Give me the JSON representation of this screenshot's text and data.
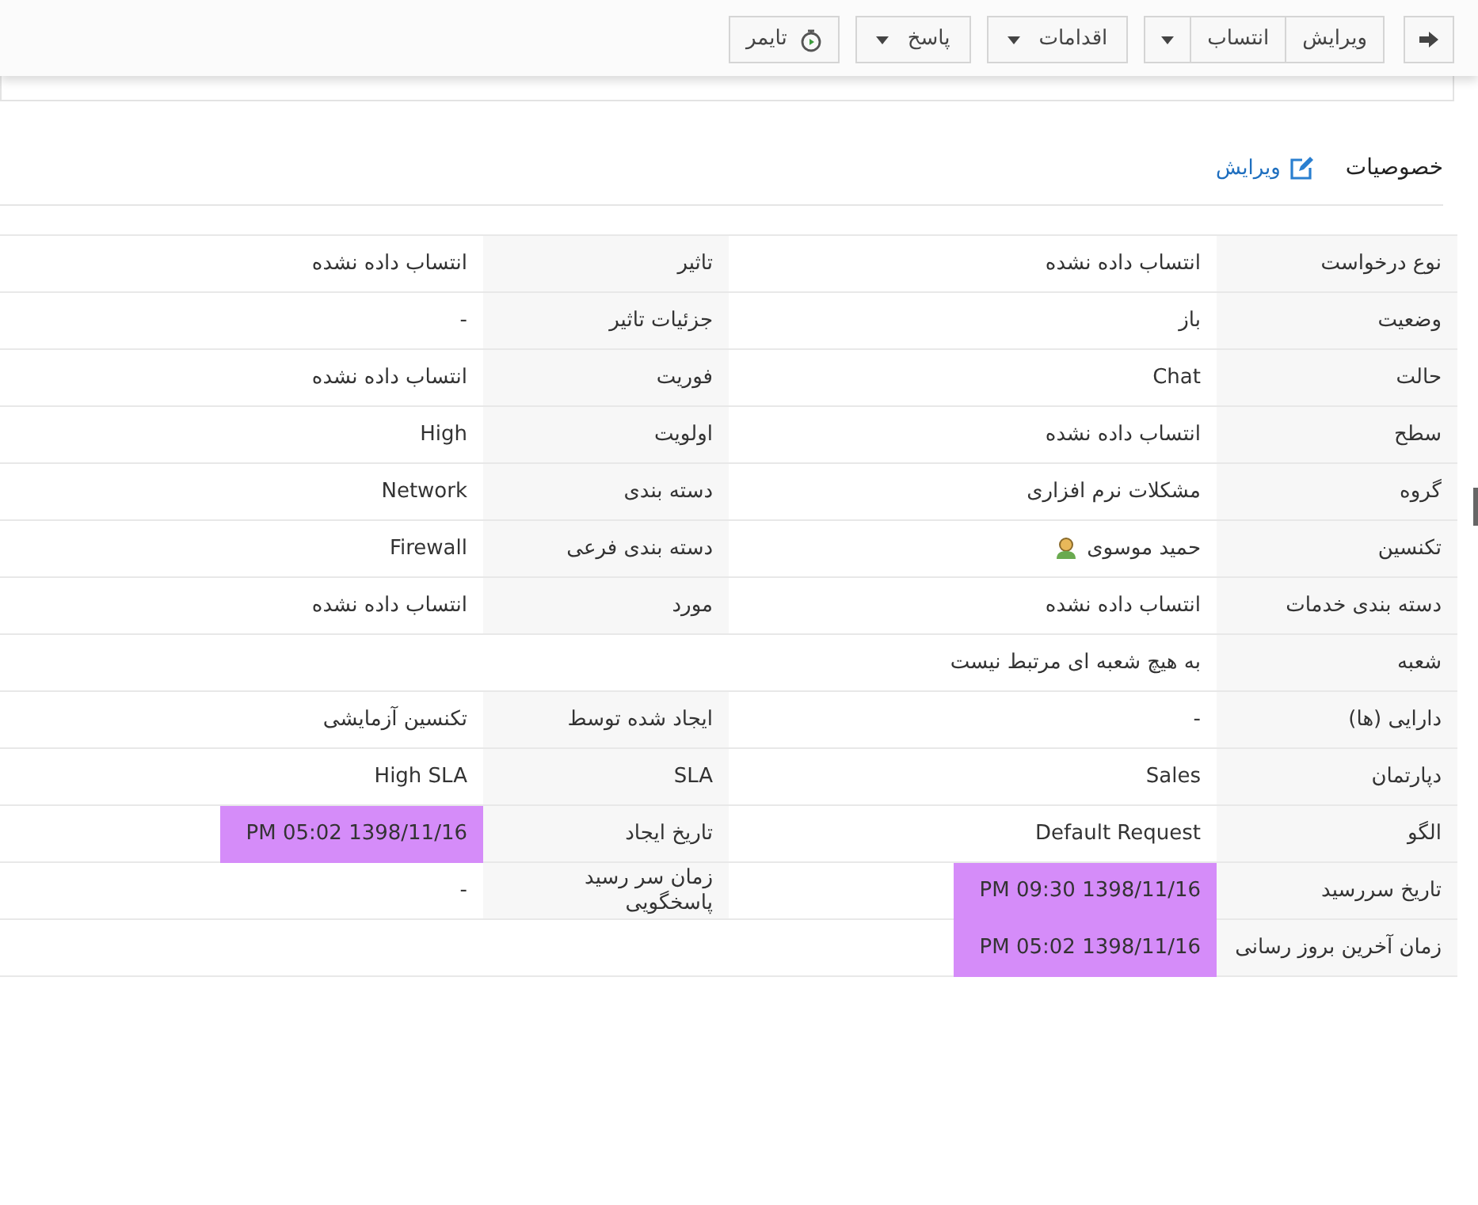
{
  "toolbar": {
    "buttons": [
      {
        "label": "ویرایش",
        "kind": "plain"
      },
      {
        "label": "انتساب",
        "kind": "split"
      },
      {
        "label": "اقدامات",
        "kind": "dropdown"
      },
      {
        "label": "پاسخ",
        "kind": "dropdown"
      },
      {
        "label": "تایمر",
        "kind": "timer"
      }
    ]
  },
  "section": {
    "title": "خصوصیات",
    "edit_link": "ویرایش"
  },
  "rows": [
    {
      "right": {
        "label": "نوع درخواست",
        "value": "انتساب داده نشده"
      },
      "left": {
        "label": "تاثیر",
        "value": "انتساب داده نشده"
      }
    },
    {
      "right": {
        "label": "وضعیت",
        "value": "باز"
      },
      "left": {
        "label": "جزئیات تاثیر",
        "value": "-"
      }
    },
    {
      "right": {
        "label": "حالت",
        "value": "Chat"
      },
      "left": {
        "label": "فوریت",
        "value": "انتساب داده نشده"
      }
    },
    {
      "right": {
        "label": "سطح",
        "value": "انتساب داده نشده"
      },
      "left": {
        "label": "اولویت",
        "value": "High"
      }
    },
    {
      "right": {
        "label": "گروه",
        "value": "مشکلات نرم افزاری"
      },
      "left": {
        "label": "دسته بندی",
        "value": "Network"
      }
    },
    {
      "right": {
        "label": "تکنسین",
        "value": "حمید موسوی",
        "kind": "user"
      },
      "left": {
        "label": "دسته بندی فرعی",
        "value": "Firewall"
      }
    },
    {
      "right": {
        "label": "دسته بندی خدمات",
        "value": "انتساب داده نشده"
      },
      "left": {
        "label": "مورد",
        "value": "انتساب داده نشده"
      }
    },
    {
      "right": {
        "label": "شعبه",
        "value": "به هیچ شعبه ای مرتبط نیست"
      }
    },
    {
      "right": {
        "label": "دارایی (ها)",
        "value": "-"
      },
      "left": {
        "label": "ایجاد شده توسط",
        "value": "تکنسین آزمایشی"
      }
    },
    {
      "right": {
        "label": "دپارتمان",
        "value": "Sales"
      },
      "left": {
        "label": "SLA",
        "value": "High SLA"
      }
    },
    {
      "right": {
        "label": "الگو",
        "value": "Default Request"
      },
      "left": {
        "label": "تاریخ ایجاد",
        "value": "PM 05:02 1398/11/16",
        "color": "#d58cf9"
      }
    },
    {
      "right": {
        "label": "تاریخ سررسید",
        "value": "PM 09:30 1398/11/16",
        "color": "#d58cf9"
      },
      "left": {
        "label": "زمان سر رسید پاسخگویی",
        "value": "-"
      }
    },
    {
      "right": {
        "label": "زمان آخرین بروز رسانی",
        "value": "PM 05:02 1398/11/16",
        "color": "#d58cf9"
      }
    }
  ]
}
